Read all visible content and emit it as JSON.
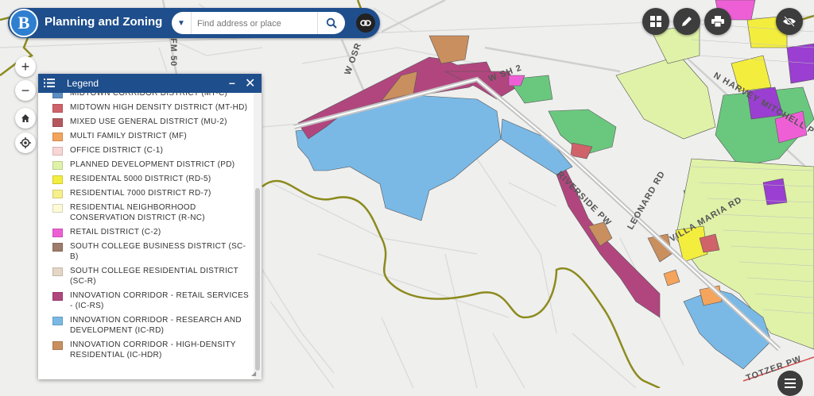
{
  "app": {
    "title": "Planning and Zoning",
    "logo_letter": "B"
  },
  "search": {
    "placeholder": "Find address or place",
    "dropdown_icon": "caret-down-icon",
    "button_icon": "search-icon"
  },
  "toolbar": {
    "link_icon": "link-icon",
    "tools": [
      "grid-icon",
      "pencil-icon",
      "print-icon",
      "eye-slash-icon"
    ]
  },
  "nav": {
    "zoom_in": "+",
    "zoom_out": "−",
    "home_icon": "home-icon",
    "locate_icon": "crosshair-icon"
  },
  "legend": {
    "title": "Legend",
    "minimize": "–",
    "close": "✕",
    "items": [
      {
        "label": "MIDTOWN CORRIDOR DISTRICT (MT-C)",
        "color": "#5b8fc4"
      },
      {
        "label": "MIDTOWN HIGH DENSITY DISTRICT (MT-HD)",
        "color": "#d0626a"
      },
      {
        "label": "MIXED USE GENERAL DISTRICT (MU-2)",
        "color": "#b5585e"
      },
      {
        "label": "MULTI FAMILY DISTRICT (MF)",
        "color": "#f4a45c"
      },
      {
        "label": "OFFICE DISTRICT (C-1)",
        "color": "#f9d5d5"
      },
      {
        "label": "PLANNED DEVELOPMENT DISTRICT (PD)",
        "color": "#dff2a8"
      },
      {
        "label": "RESIDENTAL 5000 DISTRICT (RD-5)",
        "color": "#f3ee3e"
      },
      {
        "label": "RESIDENTIAL 7000 DISTRICT RD-7)",
        "color": "#f7f08a"
      },
      {
        "label": "RESIDENTIAL NEIGHBORHOOD CONSERVATION DISTRICT (R-NC)",
        "color": "#fdfbd6"
      },
      {
        "label": "RETAIL DISTRICT (C-2)",
        "color": "#ee5fd6"
      },
      {
        "label": "SOUTH COLLEGE BUSINESS DISTRICT (SC-B)",
        "color": "#9e7b6a"
      },
      {
        "label": "SOUTH COLLEGE RESIDENTIAL DISTRICT (SC-R)",
        "color": "#e4d7c6"
      },
      {
        "label": "INNOVATION CORRIDOR - RETAIL SERVICES - (IC-RS)",
        "color": "#b1467e"
      },
      {
        "label": "INNOVATION CORRIDOR - RESEARCH AND DEVELOPMENT (IC-RD)",
        "color": "#7ab9e6"
      },
      {
        "label": "INNOVATION CORRIDOR - HIGH-DENSITY RESIDENTIAL (IC-HDR)",
        "color": "#c98f5e"
      }
    ]
  },
  "map": {
    "road_labels": [
      "FM 50",
      "W OSR",
      "W SH 2",
      "N HARVEY MITCHELL PW",
      "RIVERSIDE PW",
      "LEONARD RD",
      "VILLA MARIA RD",
      "TOTZER PW"
    ],
    "layers_icon": "layers-list-icon"
  },
  "colors": {
    "header": "#1e4e8c",
    "river": "#8c8b1e"
  }
}
